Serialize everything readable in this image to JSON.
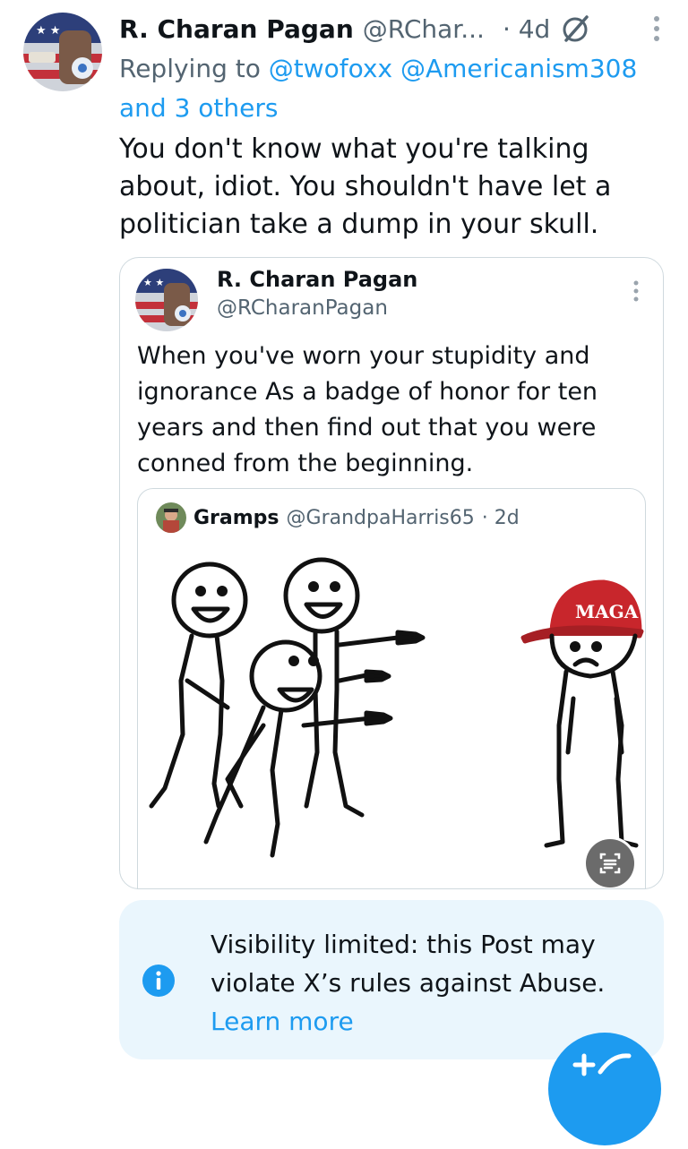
{
  "post": {
    "author_name": "R. Charan Pagan",
    "author_handle": "@RChar...",
    "time": "· 4d",
    "replying_prefix": "Replying to",
    "replying_users": "@twofoxx @Americanism308 and 3 others",
    "text": "You don't know what you're talking about, idiot. You shouldn't have let a politician take a dump in your skull."
  },
  "quote": {
    "author_name": "R. Charan Pagan",
    "author_handle": "@RCharanPagan",
    "text": "When you've worn your stupidity and ignorance As a badge of honor for ten years and then find out that you were conned from the beginning."
  },
  "inner_quote": {
    "author_name": "Gramps",
    "author_handle": "@GrandpaHarris65",
    "time": "· 2d",
    "hat_text": "MAGA"
  },
  "notice": {
    "text": "Visibility limited: this Post may violate X’s rules against Abuse.",
    "link": "Learn more"
  },
  "colors": {
    "accent": "#1d9bf0",
    "notice_bg": "#eaf6fd",
    "secondary_text": "#536471",
    "border": "#cfd9de",
    "hat_red": "#c8262c"
  },
  "icons": [
    "grok-icon",
    "more-icon",
    "info-icon",
    "scan-text-icon",
    "compose-icon"
  ]
}
